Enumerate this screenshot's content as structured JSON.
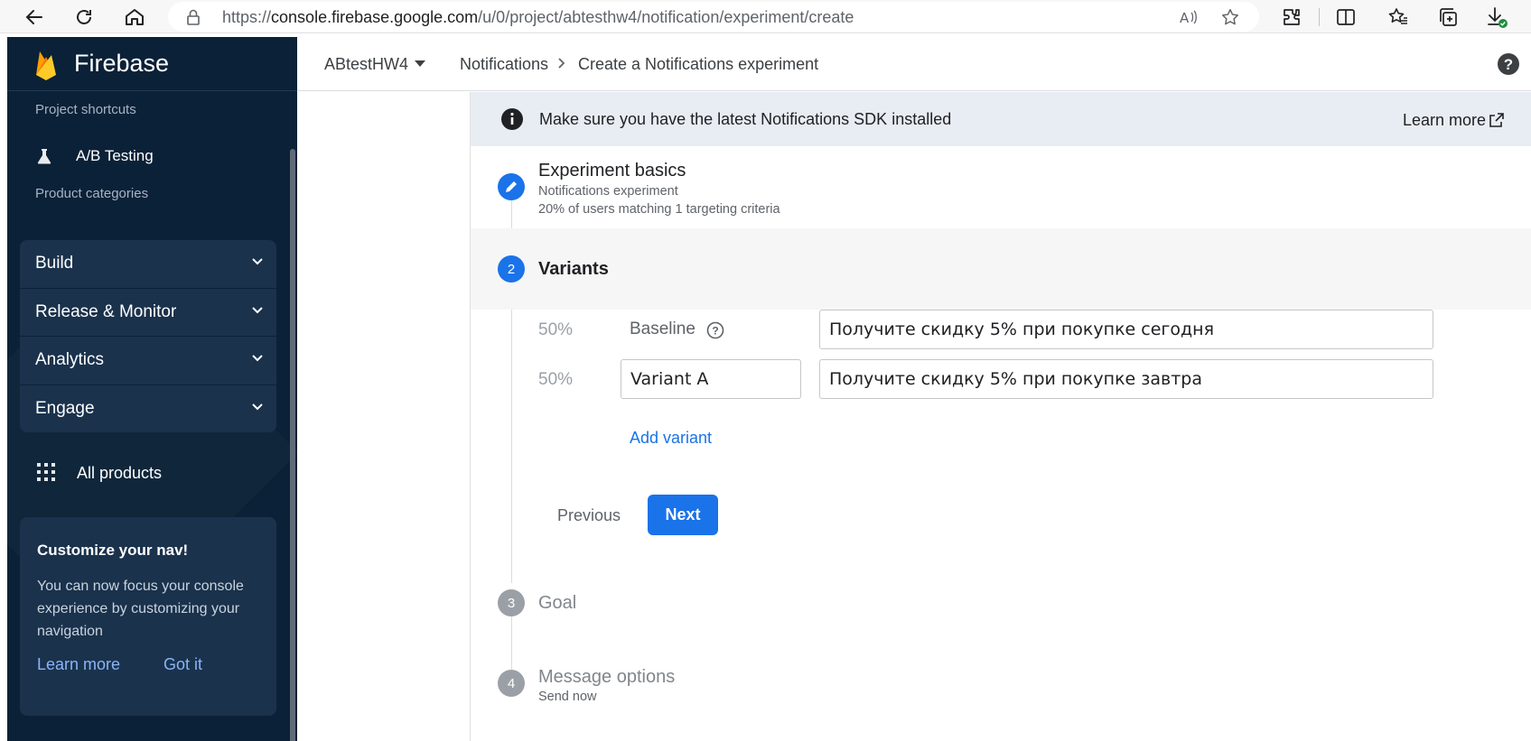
{
  "browser": {
    "url_prefix": "https://",
    "url_host": "console.firebase.google.com",
    "url_path": "/u/0/project/abtesthw4/notification/experiment/create"
  },
  "sidebar": {
    "brand": "Firebase",
    "shortcuts_label": "Project shortcuts",
    "shortcut_item": "A/B Testing",
    "categories_label": "Product categories",
    "categories": [
      "Build",
      "Release & Monitor",
      "Analytics",
      "Engage"
    ],
    "all_products": "All products",
    "customize": {
      "title": "Customize your nav!",
      "body": "You can now focus your console experience by customizing your navigation",
      "learn_more": "Learn more",
      "got_it": "Got it"
    }
  },
  "header": {
    "project": "ABtestHW4",
    "crumb_1": "Notifications",
    "crumb_2": "Create a Notifications experiment"
  },
  "banner": {
    "message": "Make sure you have the latest Notifications SDK installed",
    "learn_more": "Learn more"
  },
  "steps": {
    "step1": {
      "title": "Experiment basics",
      "subtitle_1": "Notifications experiment",
      "subtitle_2": "20% of users matching 1 targeting criteria"
    },
    "step2": {
      "number": "2",
      "title": "Variants",
      "variants": [
        {
          "percent": "50%",
          "name": "Baseline",
          "text": "Получите скидку 5% при покупке сегодня"
        },
        {
          "percent": "50%",
          "name": "Variant A",
          "text": "Получите скидку 5% при покупке завтра"
        }
      ],
      "add_variant": "Add variant",
      "previous": "Previous",
      "next": "Next"
    },
    "step3": {
      "number": "3",
      "title": "Goal"
    },
    "step4": {
      "number": "4",
      "title": "Message options",
      "subtitle": "Send now"
    }
  },
  "colors": {
    "accent": "#1a73e8",
    "sidebar_bg": "#0b2137",
    "banner_bg": "#e8edf3"
  }
}
